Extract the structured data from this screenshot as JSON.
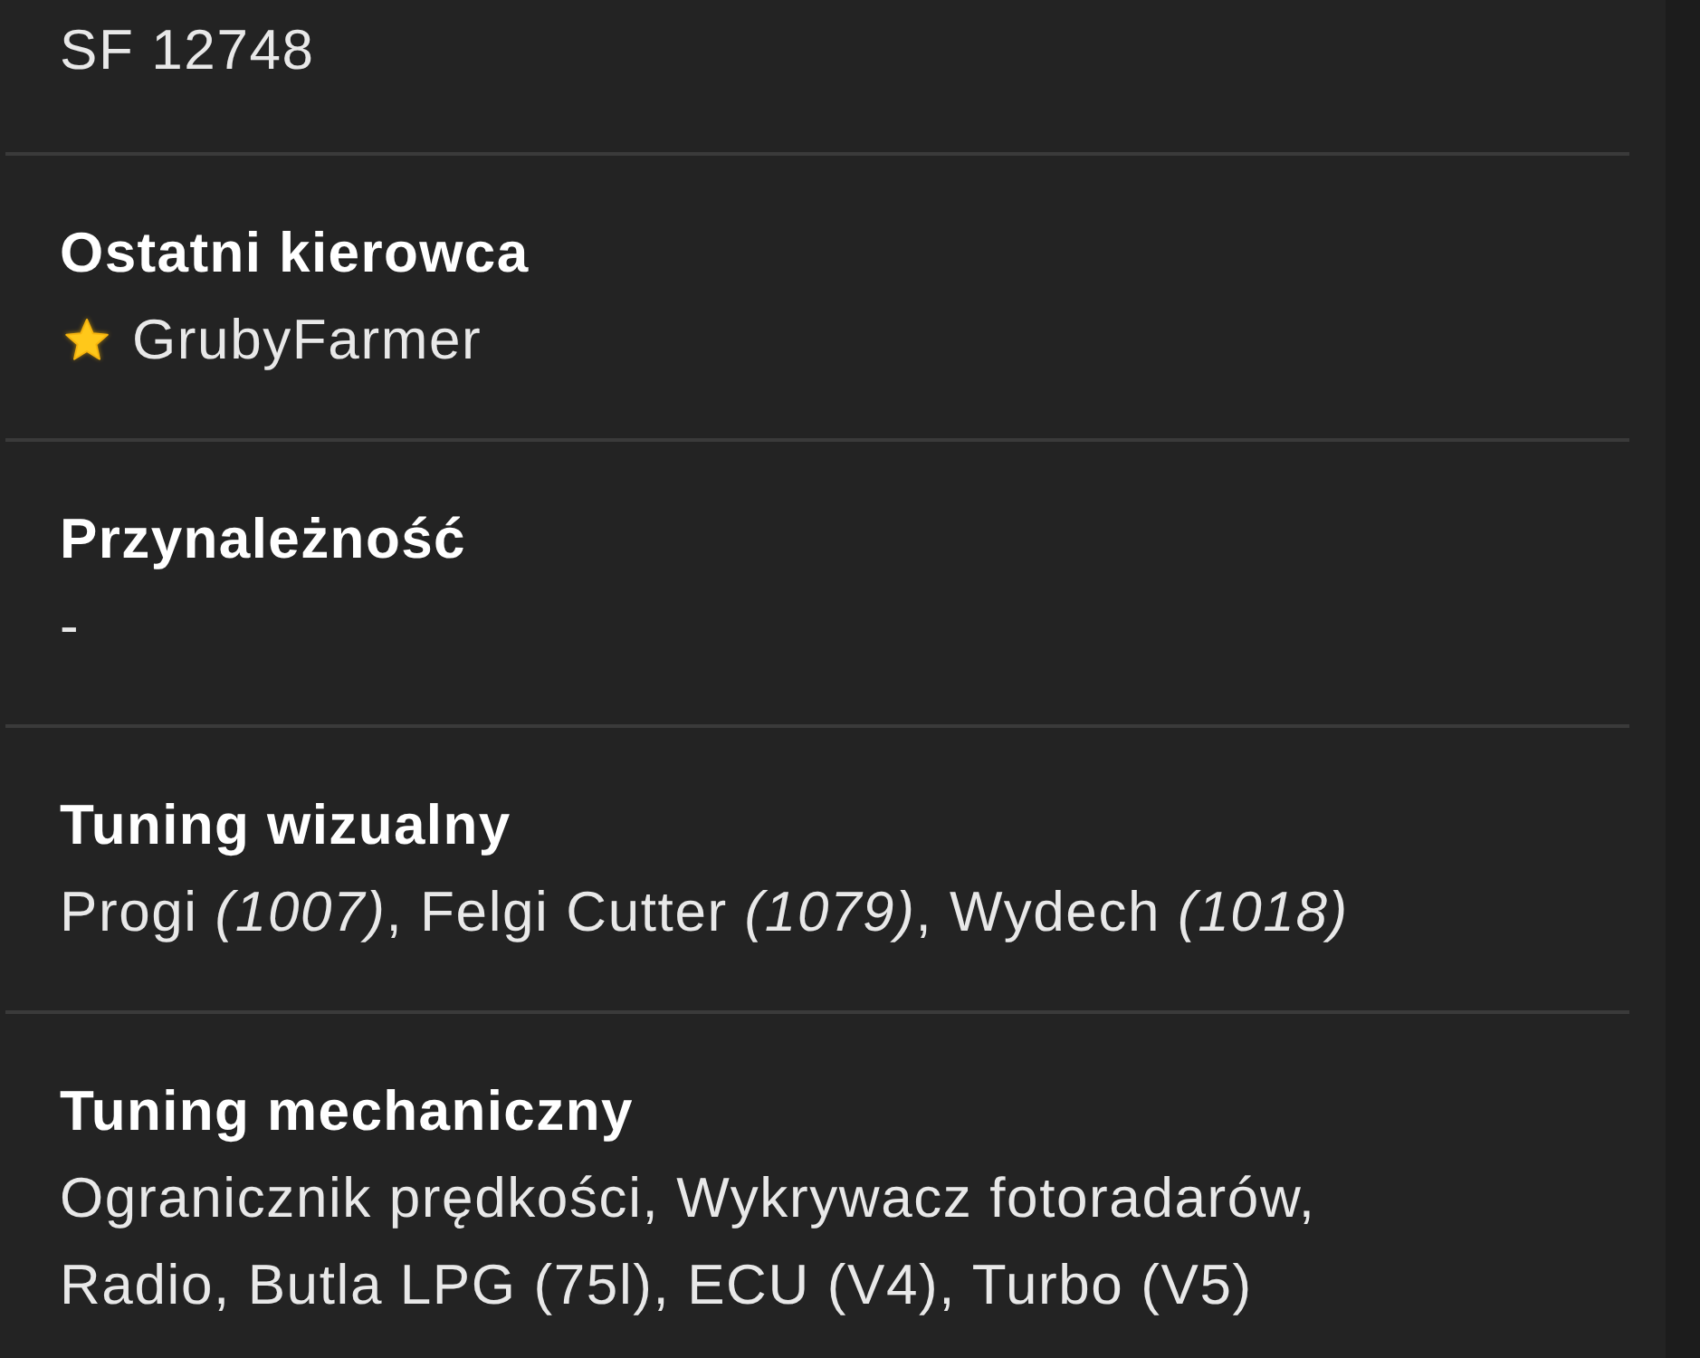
{
  "fields": [
    {
      "value": "SF 12748",
      "starred": false
    },
    {
      "label": "Ostatni kierowca",
      "value": "GrubyFarmer",
      "starred": true
    },
    {
      "label": "Przynależność",
      "value": "-",
      "starred": false
    },
    {
      "label": "Tuning wizualny",
      "value": "Progi *(1007)*, Felgi Cutter *(1079)*, Wydech *(1018)*",
      "starred": false
    },
    {
      "label": "Tuning mechaniczny",
      "value": "Ogranicznik prędkości, Wykrywacz fotoradarów, Radio, Butla LPG (75l), ECU (V4), Turbo (V5)",
      "starred": false
    }
  ]
}
